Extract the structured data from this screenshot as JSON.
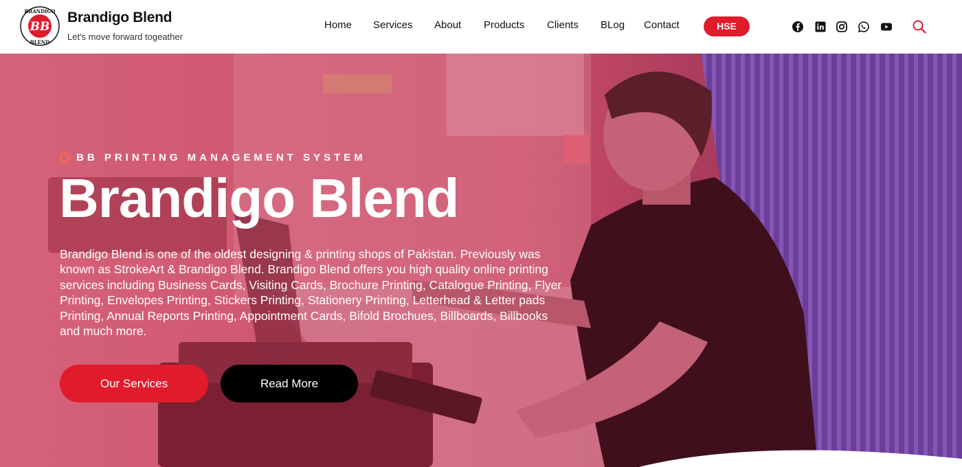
{
  "brand": {
    "name": "Brandigo Blend",
    "tagline": "Let's move forward togeather",
    "logo_text_top": "BRANDIGO",
    "logo_text_bottom": "BLEND",
    "logo_monogram": "BB"
  },
  "nav": {
    "items": [
      {
        "label": "Home"
      },
      {
        "label": "Services"
      },
      {
        "label": "About"
      },
      {
        "label": "Products"
      },
      {
        "label": "Clients"
      },
      {
        "label": "BLog"
      },
      {
        "label": "Contact"
      }
    ],
    "cta": "HSE"
  },
  "social": [
    "facebook-icon",
    "linkedin-icon",
    "instagram-icon",
    "whatsapp-icon",
    "youtube-icon"
  ],
  "hero": {
    "kicker": "BB PRINTING MANAGEMENT SYSTEM",
    "title": "Brandigo Blend",
    "description": "Brandigo Blend is one of the oldest designing & printing shops of Pakistan. Previously was known as StrokeArt & Brandigo Blend.  Brandigo Blend offers you high quality online printing services including Business Cards, Visiting Cards, Brochure Printing, Catalogue Printing, Flyer Printing, Envelopes Printing, Stickers Printing, Stationery Printing, Letterhead & Letter pads Printing, Annual Reports Printing, Appointment Cards, Bifold Brochues, Billboards, Billbooks and much more.",
    "primary_button": "Our Services",
    "secondary_button": "Read More"
  },
  "colors": {
    "accent": "#e01b2c",
    "overlay": "#c94a63",
    "kicker_dot": "#f26b4f",
    "dark": "#000000"
  }
}
